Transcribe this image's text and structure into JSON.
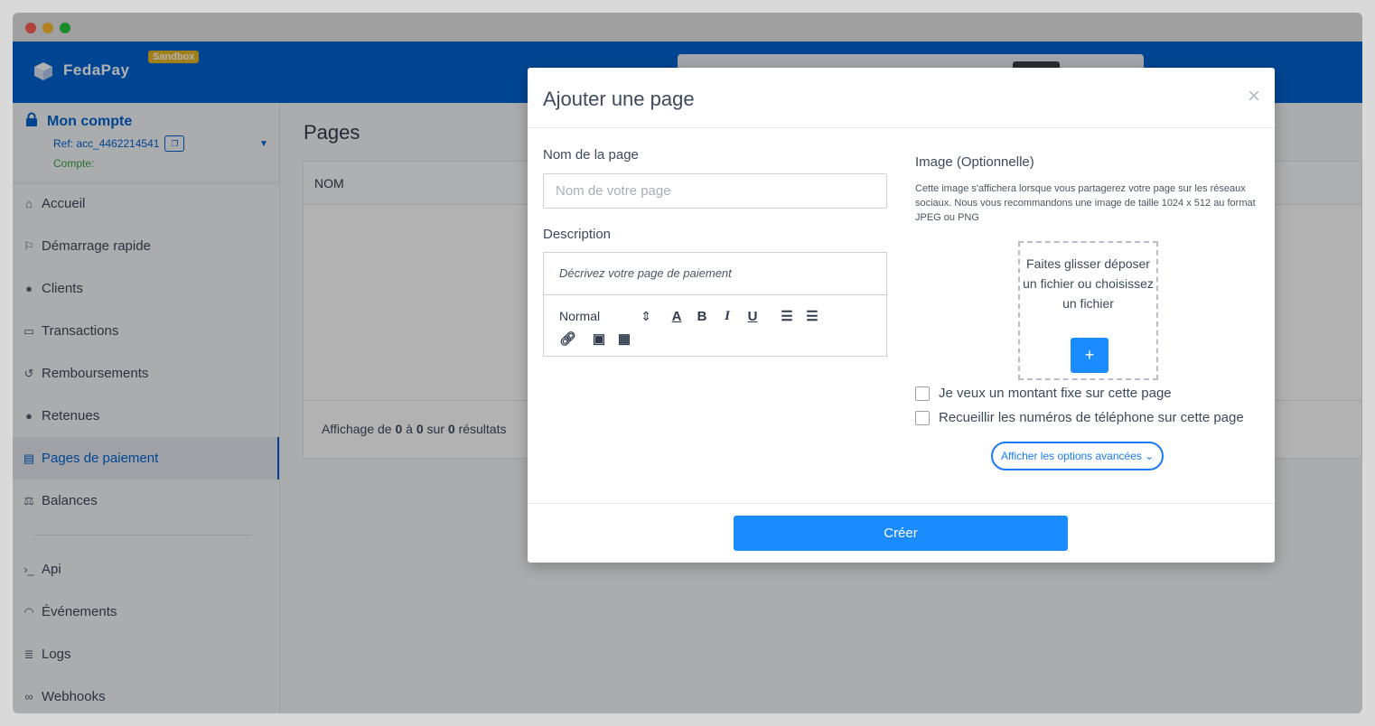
{
  "brand": {
    "name": "FedaPay",
    "badge": "Sandbox"
  },
  "account": {
    "name": "Mon compte",
    "ref": "Ref: acc_4462214541",
    "compte": "Compte:"
  },
  "nav": [
    {
      "label": "Accueil",
      "icon": "home-icon",
      "glyph": "⌂"
    },
    {
      "label": "Démarrage rapide",
      "icon": "flag-icon",
      "glyph": "⚐"
    },
    {
      "label": "Clients",
      "icon": "user-icon",
      "glyph": "●"
    },
    {
      "label": "Transactions",
      "icon": "money-icon",
      "glyph": "▭"
    },
    {
      "label": "Remboursements",
      "icon": "refund-icon",
      "glyph": "↺"
    },
    {
      "label": "Retenues",
      "icon": "alert-icon",
      "glyph": "●"
    },
    {
      "label": "Pages de paiement",
      "icon": "document-icon",
      "glyph": "▤"
    },
    {
      "label": "Balances",
      "icon": "balance-icon",
      "glyph": "⚖"
    },
    {
      "label": "Api",
      "icon": "terminal-icon",
      "glyph": "›_"
    },
    {
      "label": "Événements",
      "icon": "rss-icon",
      "glyph": "◠"
    },
    {
      "label": "Logs",
      "icon": "logs-icon",
      "glyph": "≣"
    },
    {
      "label": "Webhooks",
      "icon": "link-icon",
      "glyph": "∞"
    }
  ],
  "page": {
    "title": "Pages",
    "column": "NOM",
    "footer": {
      "prefix": "Affichage de ",
      "from": "0",
      "mid1": " à ",
      "to": "0",
      "mid2": " sur ",
      "total": "0",
      "suffix": " résultats"
    }
  },
  "modal": {
    "title": "Ajouter une page",
    "close": "×",
    "name_label": "Nom de la page",
    "name_placeholder": "Nom de votre page",
    "desc_label": "Description",
    "desc_placeholder": "Décrivez votre page de paiement",
    "format_select": "Normal",
    "image_label": "Image (Optionnelle)",
    "image_help": "Cette image s'affichera lorsque vous partagerez votre page sur les réseaux sociaux. Nous vous recommandons une image de taille 1024 x 512 au format JPEG ou PNG",
    "drop_text": "Faites glisser déposer un fichier ou choisissez un fichier",
    "drop_button": "+",
    "fixed_amount": "Je veux un montant fixe sur cette page",
    "collect_phone": "Recueillir les numéros de téléphone sur cette page",
    "advanced": "Afficher les options avancées",
    "submit": "Créer"
  },
  "colors": {
    "primary": "#0064d2",
    "accent": "#1a8cff",
    "sandbox": "#e9b824"
  }
}
